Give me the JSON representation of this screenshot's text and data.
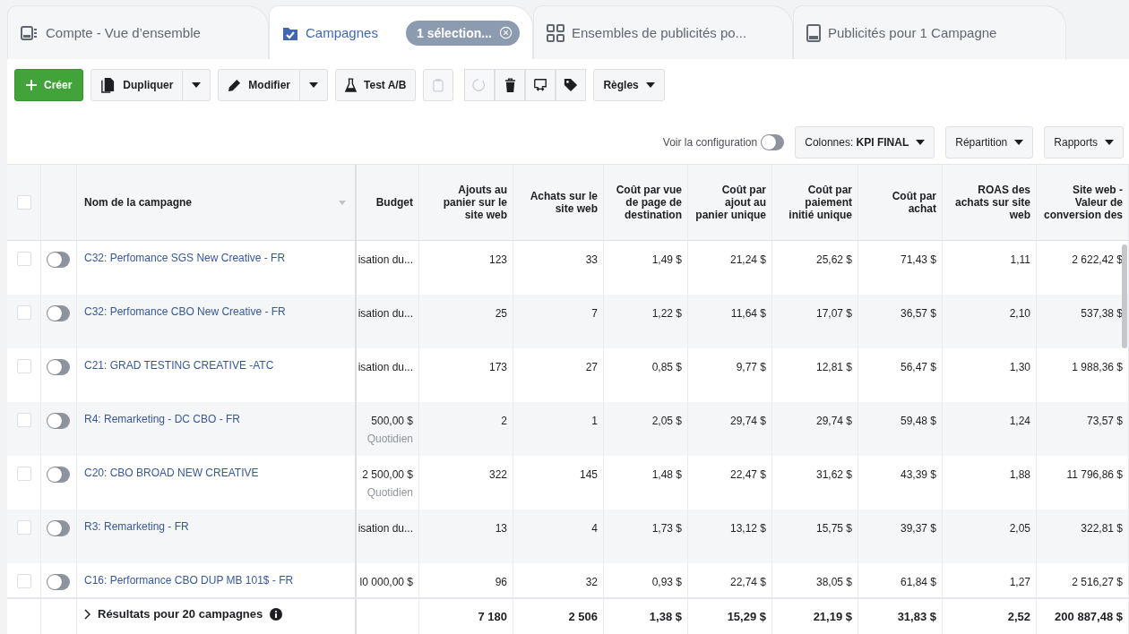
{
  "tabs": [
    {
      "kind": "account",
      "label": "Compte - Vue d’ensemble",
      "selected": false
    },
    {
      "kind": "campaigns",
      "label": "Campagnes",
      "selected": true,
      "chip": "1 sélection..."
    },
    {
      "kind": "adsets",
      "label": "Ensembles de publicités po...",
      "selected": false
    },
    {
      "kind": "ads",
      "label": "Publicités pour 1 Campagne",
      "selected": false
    }
  ],
  "toolbar": {
    "create": "Créer",
    "duplicate": "Dupliquer",
    "edit": "Modifier",
    "ab_test": "Test A/B",
    "rules": "Règles",
    "icon_buttons": [
      {
        "kind": "clipboard",
        "disabled": true
      },
      {
        "kind": "refresh",
        "disabled": true
      },
      {
        "kind": "trash",
        "disabled": false
      },
      {
        "kind": "swap",
        "disabled": false
      },
      {
        "kind": "tag",
        "disabled": false
      }
    ]
  },
  "view_bar": {
    "config_label": "Voir la configuration",
    "config_on": false,
    "columns": "Colonnes: **KPI FINAL**",
    "breakdown": "Répartition",
    "reports": "Rapports"
  },
  "table": {
    "select_all_checked": false,
    "columns": [
      "Nom de la campagne",
      "Budget",
      "Ajouts au panier sur le site web",
      "Achats sur le site web",
      "Coût par vue de page de destination",
      "Coût par ajout au panier unique",
      "Coût par paiement initié unique",
      "Coût par achat",
      "ROAS des achats sur site web",
      "Site web - Valeur de conversion des"
    ],
    "rows": [
      {
        "checked": false,
        "on": false,
        "name": "C32: Perfomance SGS New Creative - FR",
        "budget": "isation du...",
        "values": [
          "123",
          "33",
          "1,49 $",
          "21,24 $",
          "25,62 $",
          "71,43 $",
          "1,11",
          "2 622,42 $"
        ]
      },
      {
        "checked": false,
        "on": false,
        "name": "C32: Perfomance CBO New Creative - FR",
        "budget": "isation du...",
        "values": [
          "25",
          "7",
          "1,22 $",
          "11,64 $",
          "17,07 $",
          "36,57 $",
          "2,10",
          "537,38 $"
        ]
      },
      {
        "checked": false,
        "on": false,
        "name": "C21: GRAD TESTING CREATIVE -ATC",
        "budget": "isation du...",
        "values": [
          "173",
          "27",
          "0,85 $",
          "9,77 $",
          "12,81 $",
          "56,47 $",
          "1,30",
          "1 988,36 $"
        ]
      },
      {
        "checked": false,
        "on": false,
        "name": "R4: Remarketing - DC CBO - FR",
        "budget": "500,00 $",
        "budget_note": "Quotidien",
        "values": [
          "2",
          "1",
          "2,05 $",
          "29,74 $",
          "29,74 $",
          "59,48 $",
          "1,24",
          "73,57 $"
        ]
      },
      {
        "checked": false,
        "on": false,
        "name": "C20: CBO BROAD NEW CREATIVE",
        "budget": "2 500,00 $",
        "budget_note": "Quotidien",
        "values": [
          "322",
          "145",
          "1,48 $",
          "22,47 $",
          "31,62 $",
          "43,39 $",
          "1,88",
          "11 796,86 $"
        ]
      },
      {
        "checked": false,
        "on": false,
        "name": "R3: Remarketing - FR",
        "budget": "isation du...",
        "values": [
          "13",
          "4",
          "1,73 $",
          "13,12 $",
          "15,75 $",
          "39,37 $",
          "2,05",
          "322,81 $"
        ]
      },
      {
        "checked": false,
        "on": false,
        "name": "C16: Performance CBO DUP MB 101$ - FR",
        "budget": "l0 000,00 $",
        "values": [
          "96",
          "32",
          "0,93 $",
          "22,74 $",
          "38,05 $",
          "61,84 $",
          "1,27",
          "2 516,27 $"
        ]
      }
    ],
    "summary": {
      "label": "Résultats pour 20 campagnes",
      "values": [
        "7 180",
        "2 506",
        "1,38 $",
        "15,29 $",
        "21,19 $",
        "31,83 $",
        "2,52",
        "200 887,48 $"
      ]
    }
  }
}
